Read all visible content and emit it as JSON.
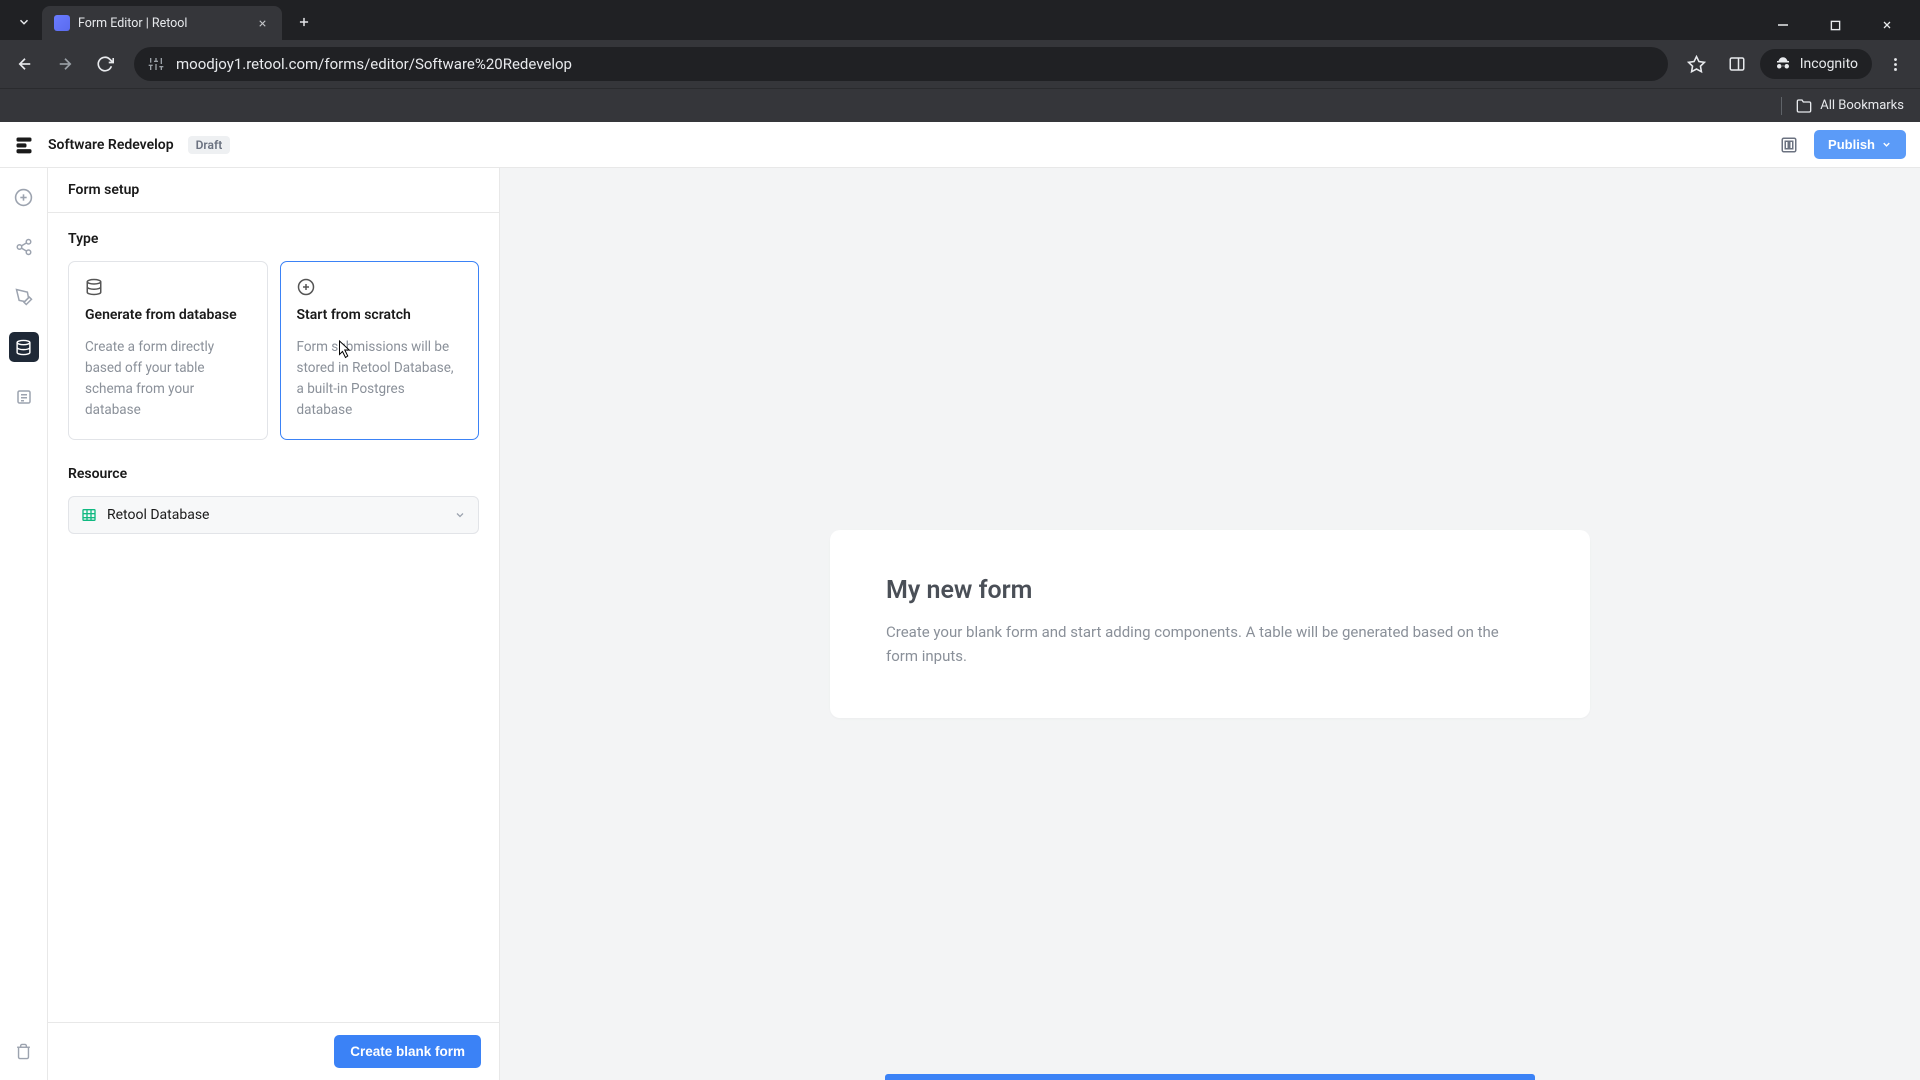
{
  "browser": {
    "tab_title": "Form Editor | Retool",
    "url": "moodjoy1.retool.com/forms/editor/Software%20Redevelop",
    "incognito_label": "Incognito",
    "all_bookmarks": "All Bookmarks"
  },
  "header": {
    "app_name": "Software Redevelop",
    "status": "Draft",
    "publish": "Publish"
  },
  "panel": {
    "title": "Form setup",
    "type_label": "Type",
    "cards": {
      "db": {
        "title": "Generate from database",
        "desc": "Create a form directly based off your table schema from your database"
      },
      "scratch": {
        "title": "Start from scratch",
        "desc": "Form submissions will be stored in Retool Database, a built-in Postgres database"
      }
    },
    "resource_label": "Resource",
    "resource_value": "Retool Database",
    "create_button": "Create blank form"
  },
  "canvas": {
    "form_title": "My new form",
    "form_desc": "Create your blank form and start adding components. A table will be generated based on the form inputs."
  }
}
